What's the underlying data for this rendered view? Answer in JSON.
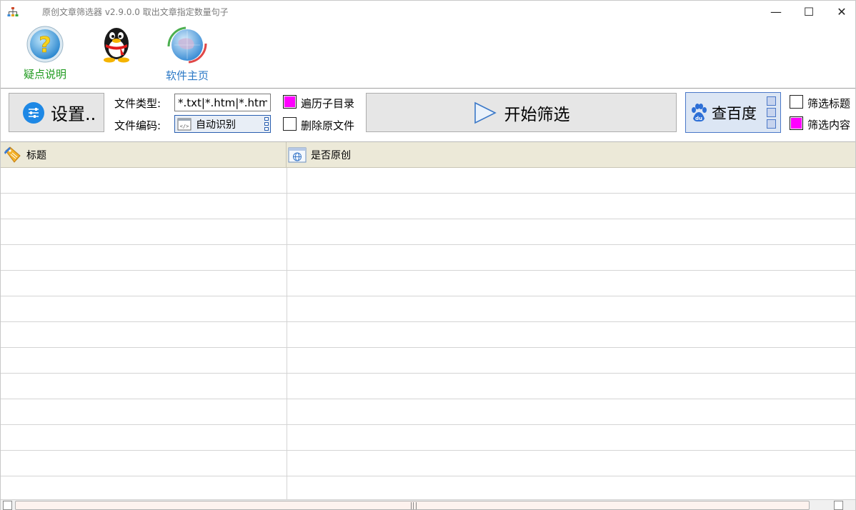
{
  "window": {
    "title": "原创文章筛选器 v2.9.0.0 取出文章指定数量句子查",
    "controls": {
      "minimize": "—",
      "maximize": "☐",
      "close": "✕"
    }
  },
  "toolbar": {
    "help_label": "疑点说明",
    "home_label": "软件主页",
    "qq_icon": "qq-penguin-icon",
    "help_color": "#1f9a1f",
    "home_color": "#2a78c6"
  },
  "controls": {
    "settings_label": "设置..",
    "file_type_label": "文件类型:",
    "file_type_value": "*.txt|*.htm|*.html",
    "file_encoding_label": "文件编码:",
    "file_encoding_value": "自动识别",
    "recurse_label": "遍历子目录",
    "recurse_checked": true,
    "delete_label": "删除原文件",
    "delete_checked": false,
    "start_label": "开始筛选",
    "baidu_label": "查百度",
    "filter_title_label": "筛选标题",
    "filter_title_checked": false,
    "filter_content_label": "筛选内容",
    "filter_content_checked": true,
    "checked_color": "#ff00ff"
  },
  "grid": {
    "columns": [
      "标题",
      "是否原创"
    ],
    "rows": [
      [
        "",
        ""
      ],
      [
        "",
        ""
      ],
      [
        "",
        ""
      ],
      [
        "",
        ""
      ],
      [
        "",
        ""
      ],
      [
        "",
        ""
      ],
      [
        "",
        ""
      ],
      [
        "",
        ""
      ],
      [
        "",
        ""
      ],
      [
        "",
        ""
      ],
      [
        "",
        ""
      ],
      [
        "",
        ""
      ],
      [
        "",
        ""
      ]
    ]
  }
}
